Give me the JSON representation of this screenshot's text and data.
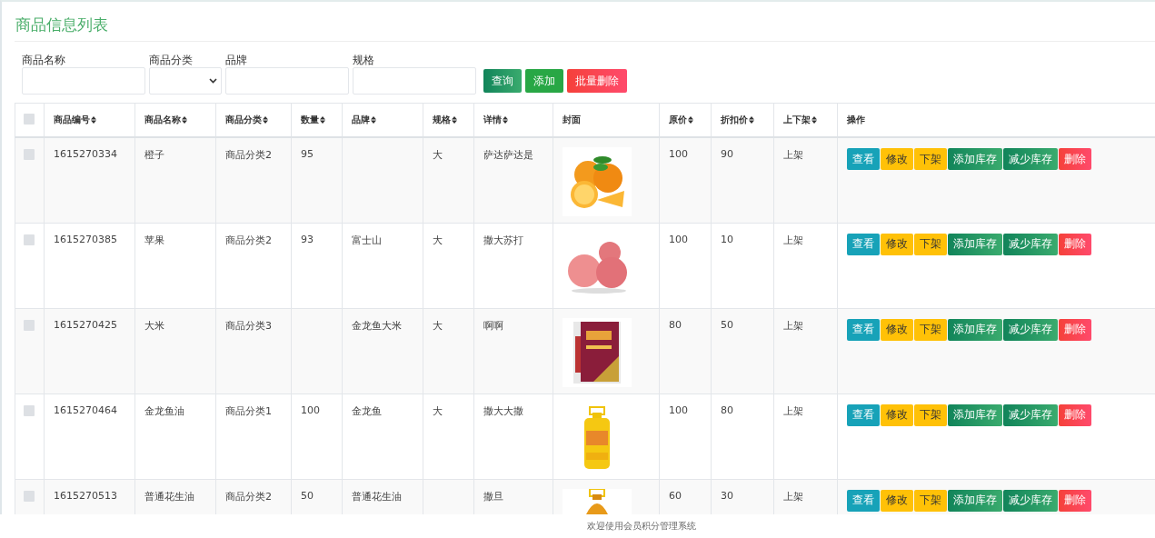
{
  "title": "商品信息列表",
  "filters": [
    {
      "kind": "text",
      "label": "商品名称"
    },
    {
      "kind": "select",
      "label": "商品分类"
    },
    {
      "kind": "text",
      "label": "品牌"
    },
    {
      "kind": "text",
      "label": "规格"
    }
  ],
  "filter_buttons": [
    {
      "label": "查询",
      "kind": "success"
    },
    {
      "label": "添加",
      "kind": "primary"
    },
    {
      "label": "批量删除",
      "kind": "danger"
    }
  ],
  "table": {
    "select_all": {
      "checked": false
    },
    "columns": [
      {
        "label": "商品编号",
        "sortable": true
      },
      {
        "label": "商品名称",
        "sortable": true
      },
      {
        "label": "商品分类",
        "sortable": true
      },
      {
        "label": "数量",
        "sortable": true
      },
      {
        "label": "品牌",
        "sortable": true
      },
      {
        "label": "规格",
        "sortable": true
      },
      {
        "label": "详情",
        "sortable": true
      },
      {
        "label": "封面",
        "sortable": false
      },
      {
        "label": "原价",
        "sortable": true
      },
      {
        "label": "折扣价",
        "sortable": true
      },
      {
        "label": "上下架",
        "sortable": true
      },
      {
        "label": "操作",
        "sortable": false
      }
    ],
    "rows": [
      {
        "checked": false,
        "cells": [
          "1615270334",
          "橙子",
          "商品分类2",
          "95",
          "",
          "大",
          "萨达萨达是"
        ],
        "cover": {
          "kind": "picture"
        },
        "cells2": [
          "100",
          "90",
          "上架"
        ],
        "actions": [
          {
            "label": "查看",
            "kind": "info"
          },
          {
            "label": "修改",
            "kind": "warning"
          },
          {
            "label": "下架",
            "kind": "warning"
          },
          {
            "label": "添加库存",
            "kind": "success"
          },
          {
            "label": "减少库存",
            "kind": "success"
          },
          {
            "label": "删除",
            "kind": "danger"
          }
        ]
      },
      {
        "checked": false,
        "cells": [
          "1615270385",
          "苹果",
          "商品分类2",
          "93",
          "富士山",
          "大",
          "撒大苏打"
        ],
        "cover": {
          "kind": "picture"
        },
        "cells2": [
          "100",
          "10",
          "上架"
        ],
        "actions": [
          {
            "label": "查看",
            "kind": "info"
          },
          {
            "label": "修改",
            "kind": "warning"
          },
          {
            "label": "下架",
            "kind": "warning"
          },
          {
            "label": "添加库存",
            "kind": "success"
          },
          {
            "label": "减少库存",
            "kind": "success"
          },
          {
            "label": "删除",
            "kind": "danger"
          }
        ]
      },
      {
        "checked": false,
        "cells": [
          "1615270425",
          "大米",
          "商品分类3",
          "",
          "金龙鱼大米",
          "大",
          "啊啊"
        ],
        "cover": {
          "kind": "picture"
        },
        "cells2": [
          "80",
          "50",
          "上架"
        ],
        "actions": [
          {
            "label": "查看",
            "kind": "info"
          },
          {
            "label": "修改",
            "kind": "warning"
          },
          {
            "label": "下架",
            "kind": "warning"
          },
          {
            "label": "添加库存",
            "kind": "success"
          },
          {
            "label": "减少库存",
            "kind": "success"
          },
          {
            "label": "删除",
            "kind": "danger"
          }
        ]
      },
      {
        "checked": false,
        "cells": [
          "1615270464",
          "金龙鱼油",
          "商品分类1",
          "100",
          "金龙鱼",
          "大",
          "撒大大撒"
        ],
        "cover": {
          "kind": "picture"
        },
        "cells2": [
          "100",
          "80",
          "上架"
        ],
        "actions": [
          {
            "label": "查看",
            "kind": "info"
          },
          {
            "label": "修改",
            "kind": "warning"
          },
          {
            "label": "下架",
            "kind": "warning"
          },
          {
            "label": "添加库存",
            "kind": "success"
          },
          {
            "label": "减少库存",
            "kind": "success"
          },
          {
            "label": "删除",
            "kind": "danger"
          }
        ]
      },
      {
        "checked": false,
        "cells": [
          "1615270513",
          "普通花生油",
          "商品分类2",
          "50",
          "普通花生油",
          "",
          "撒旦"
        ],
        "cover": {
          "kind": "picture"
        },
        "cells2": [
          "60",
          "30",
          "上架"
        ],
        "actions": [
          {
            "label": "查看",
            "kind": "info"
          },
          {
            "label": "修改",
            "kind": "warning"
          },
          {
            "label": "下架",
            "kind": "warning"
          },
          {
            "label": "添加库存",
            "kind": "success"
          },
          {
            "label": "减少库存",
            "kind": "success"
          },
          {
            "label": "删除",
            "kind": "danger"
          }
        ]
      }
    ]
  },
  "footer": "欢迎使用会员积分管理系统"
}
